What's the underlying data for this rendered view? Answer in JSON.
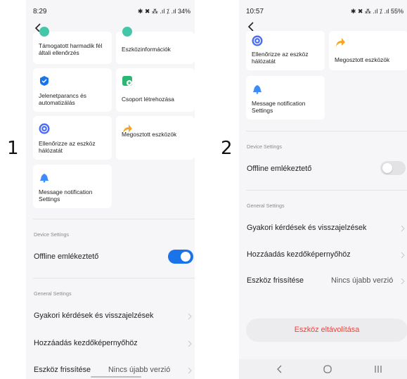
{
  "screens": {
    "one": {
      "number_label": "1",
      "status": {
        "time": "8:29",
        "indicators": "✱ ✖ ⁂ .ıl ⁒ .ıl 34%"
      },
      "tiles": {
        "t1": "Támogatott harmadik fél általi ellenőrzés",
        "t2": "Eszközinformációk",
        "t3": "Jelenetparancs és automatizálás",
        "t4": "Csoport létrehozása",
        "t5": "Ellenőrizze az eszköz hálózatát",
        "t6": "Megosztott eszközök",
        "t7": "Message notification Settings"
      },
      "device_settings": {
        "header": "Device Settings",
        "offline_label": "Offline emlékeztető",
        "offline_enabled": true
      },
      "general_settings": {
        "header": "General Settings",
        "faq": "Gyakori kérdések és visszajelzések",
        "homescreen": "Hozzáadás kezdőképernyőhöz",
        "update_label": "Eszköz frissítése",
        "update_value": "Nincs újabb verzió"
      }
    },
    "two": {
      "number_label": "2",
      "status": {
        "time": "10:57",
        "indicators": "✱ ✖ ⁂ .ıl ⁒ .ıl 55%"
      },
      "tiles": {
        "t5": "Ellenőrizze az eszköz hálózatát",
        "t6": "Megosztott eszközök",
        "t7": "Message notification Settings"
      },
      "device_settings": {
        "header": "Device Settings",
        "offline_label": "Offline emlékeztető",
        "offline_enabled": false
      },
      "general_settings": {
        "header": "General Settings",
        "faq": "Gyakori kérdések és visszajelzések",
        "homescreen": "Hozzáadás kezdőképernyőhöz",
        "update_label": "Eszköz frissítése",
        "update_value": "Nincs újabb verzió"
      },
      "remove_button": "Eszköz eltávolítása"
    }
  },
  "icons": {
    "check-shield": "#1a73e8",
    "add-group": "#2bb673",
    "network-check": "#4a6cf7",
    "share-arrow": "#f6a623",
    "bell": "#3d8bfd",
    "third-party": "#46c6a8"
  },
  "colors": {
    "toggle_on": "#1a73e8",
    "remove_text": "#e8453c"
  }
}
